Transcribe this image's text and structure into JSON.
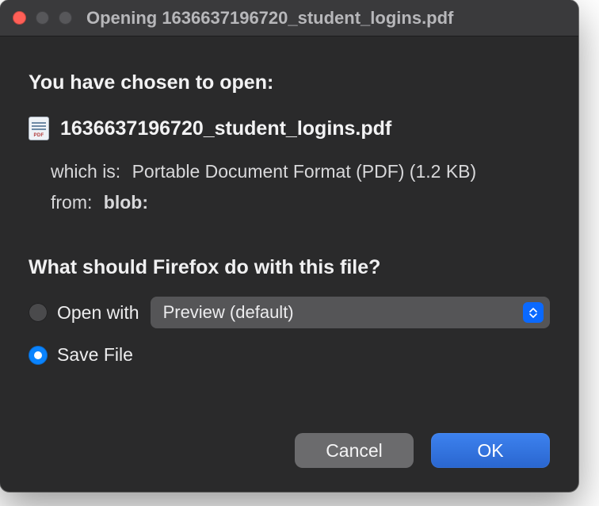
{
  "titlebar": {
    "title": "Opening 1636637196720_student_logins.pdf"
  },
  "header": {
    "chosen_to_open": "You have chosen to open:"
  },
  "file": {
    "name": "1636637196720_student_logins.pdf",
    "which_is_label": "which is:",
    "which_is_value": "Portable Document Format (PDF) (1.2 KB)",
    "from_label": "from:",
    "from_value": "blob:"
  },
  "action": {
    "prompt": "What should Firefox do with this file?",
    "open_with_label": "Open with",
    "open_with_app": "Preview (default)",
    "save_file_label": "Save File",
    "selected": "save"
  },
  "buttons": {
    "cancel": "Cancel",
    "ok": "OK"
  },
  "colors": {
    "accent": "#0a84ff",
    "primary_button": "#2e72dc",
    "window_bg": "#2a2a2b",
    "titlebar_bg": "#3a3a3c"
  }
}
